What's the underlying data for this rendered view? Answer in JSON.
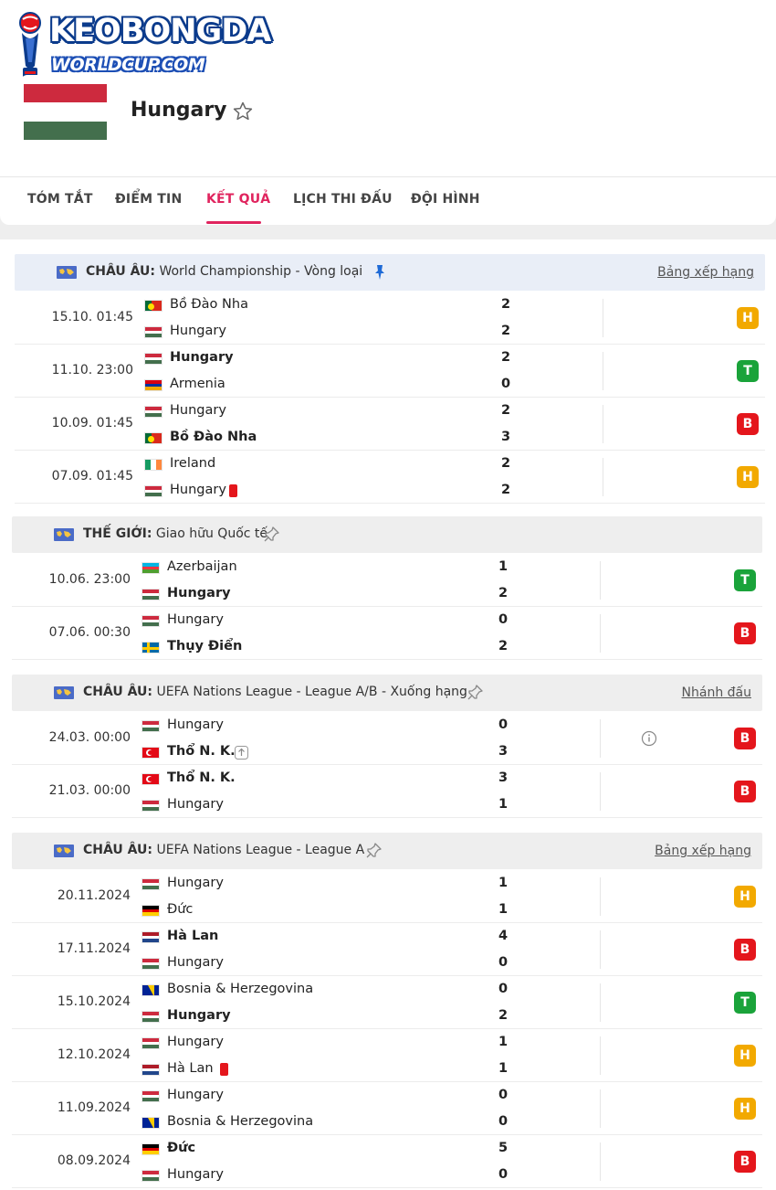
{
  "site": {
    "brand": "KEOBONGDA",
    "sub": "WORLDCUP.COM"
  },
  "team": {
    "name": "Hungary"
  },
  "tabs": [
    {
      "label": "TÓM TẮT"
    },
    {
      "label": "ĐIỂM TIN"
    },
    {
      "label": "KẾT QUẢ"
    },
    {
      "label": "LỊCH THI ĐẤU"
    },
    {
      "label": "ĐỘI HÌNH"
    }
  ],
  "colors": {
    "accent": "#e0245e",
    "draw": "#f2a900",
    "win": "#1aa33a",
    "loss": "#e4161c"
  },
  "groups": [
    {
      "region": "CHÂU ÂU:",
      "competition": "World Championship - Vòng loại",
      "link": "Bảng xếp hạng",
      "pinned": true,
      "matches": [
        {
          "date": "15.10. 01:45",
          "home": "Bồ Đào Nha",
          "home_flag": "portugal",
          "away": "Hungary",
          "away_flag": "hungary",
          "home_score": "2",
          "away_score": "2",
          "winner": "",
          "result": "H"
        },
        {
          "date": "11.10. 23:00",
          "home": "Hungary",
          "home_flag": "hungary",
          "away": "Armenia",
          "away_flag": "armenia",
          "home_score": "2",
          "away_score": "0",
          "winner": "home",
          "result": "T"
        },
        {
          "date": "10.09. 01:45",
          "home": "Hungary",
          "home_flag": "hungary",
          "away": "Bồ Đào Nha",
          "away_flag": "portugal",
          "home_score": "2",
          "away_score": "3",
          "winner": "away",
          "result": "B"
        },
        {
          "date": "07.09. 01:45",
          "home": "Ireland",
          "home_flag": "ireland",
          "away": "Hungary",
          "away_flag": "hungary",
          "home_score": "2",
          "away_score": "2",
          "winner": "",
          "result": "H",
          "away_redcard": true
        }
      ]
    },
    {
      "region": "THẾ GIỚI:",
      "competition": "Giao hữu Quốc tế",
      "link": "",
      "pinned": false,
      "matches": [
        {
          "date": "10.06. 23:00",
          "home": "Azerbaijan",
          "home_flag": "azerbaijan",
          "away": "Hungary",
          "away_flag": "hungary",
          "home_score": "1",
          "away_score": "2",
          "winner": "away",
          "result": "T"
        },
        {
          "date": "07.06. 00:30",
          "home": "Hungary",
          "home_flag": "hungary",
          "away": "Thụy Điển",
          "away_flag": "sweden",
          "home_score": "0",
          "away_score": "2",
          "winner": "away",
          "result": "B"
        }
      ]
    },
    {
      "region": "CHÂU ÂU:",
      "competition": "UEFA Nations League - League A/B - Xuống hạng",
      "link": "Nhánh đấu",
      "pinned": false,
      "matches": [
        {
          "date": "24.03. 00:00",
          "home": "Hungary",
          "home_flag": "hungary",
          "away": "Thổ N. K.",
          "away_flag": "turkey",
          "home_score": "0",
          "away_score": "3",
          "winner": "away",
          "result": "B",
          "away_up": true,
          "info": true
        },
        {
          "date": "21.03. 00:00",
          "home": "Thổ N. K.",
          "home_flag": "turkey",
          "away": "Hungary",
          "away_flag": "hungary",
          "home_score": "3",
          "away_score": "1",
          "winner": "home",
          "result": "B"
        }
      ]
    },
    {
      "region": "CHÂU ÂU:",
      "competition": "UEFA Nations League - League A",
      "link": "Bảng xếp hạng",
      "pinned": false,
      "matches": [
        {
          "date": "20.11.2024",
          "home": "Hungary",
          "home_flag": "hungary",
          "away": "Đức",
          "away_flag": "germany",
          "home_score": "1",
          "away_score": "1",
          "winner": "",
          "result": "H"
        },
        {
          "date": "17.11.2024",
          "home": "Hà Lan",
          "home_flag": "netherlands",
          "away": "Hungary",
          "away_flag": "hungary",
          "home_score": "4",
          "away_score": "0",
          "winner": "home",
          "result": "B"
        },
        {
          "date": "15.10.2024",
          "home": "Bosnia & Herzegovina",
          "home_flag": "bosnia",
          "away": "Hungary",
          "away_flag": "hungary",
          "home_score": "0",
          "away_score": "2",
          "winner": "away",
          "result": "T"
        },
        {
          "date": "12.10.2024",
          "home": "Hungary",
          "home_flag": "hungary",
          "away": "Hà Lan",
          "away_flag": "netherlands",
          "home_score": "1",
          "away_score": "1",
          "winner": "",
          "result": "H",
          "away_redcard": true
        },
        {
          "date": "11.09.2024",
          "home": "Hungary",
          "home_flag": "hungary",
          "away": "Bosnia & Herzegovina",
          "away_flag": "bosnia",
          "home_score": "0",
          "away_score": "0",
          "winner": "",
          "result": "H"
        },
        {
          "date": "08.09.2024",
          "home": "Đức",
          "home_flag": "germany",
          "away": "Hungary",
          "away_flag": "hungary",
          "home_score": "5",
          "away_score": "0",
          "winner": "home",
          "result": "B"
        }
      ]
    }
  ]
}
